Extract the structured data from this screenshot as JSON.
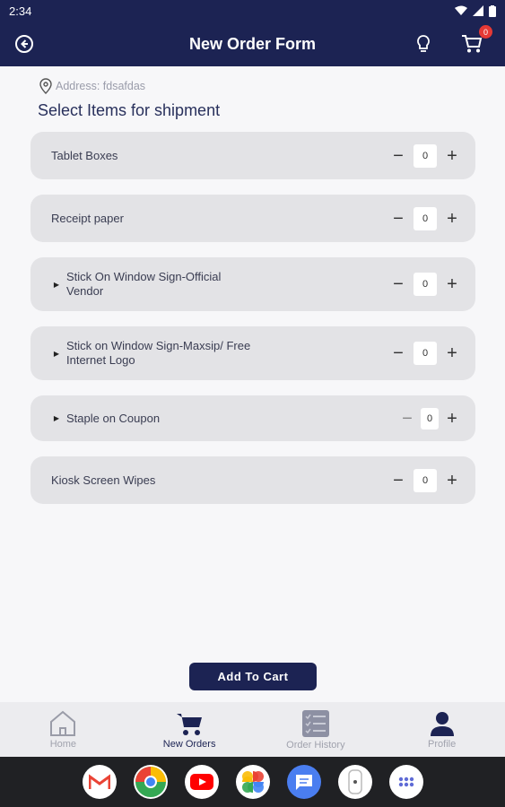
{
  "status": {
    "time": "2:34"
  },
  "appbar": {
    "title": "New Order Form",
    "cart_count": "0"
  },
  "address": {
    "text": "Address: fdsafdas"
  },
  "section_title": "Select Items for shipment",
  "items": [
    {
      "label": "Tablet Boxes",
      "qty": "0",
      "minus": "−",
      "plus": "+"
    },
    {
      "label": "Receipt paper",
      "qty": "0",
      "minus": "−",
      "plus": "+"
    },
    {
      "label": "Stick On Window Sign-Official Vendor",
      "qty": "0",
      "minus": "−",
      "plus": "+"
    },
    {
      "label": "Stick on Window Sign-Maxsip/ Free Internet Logo",
      "qty": "0",
      "minus": "−",
      "plus": "+"
    },
    {
      "label": "Staple on Coupon",
      "qty": "0",
      "minus": "−",
      "plus": "+"
    },
    {
      "label": "Kiosk Screen Wipes",
      "qty": "0",
      "minus": "−",
      "plus": "+"
    }
  ],
  "add_to_cart": "Add To Cart",
  "nav": [
    {
      "label": "Home",
      "icon": "home-icon"
    },
    {
      "label": "New Orders",
      "icon": "cart-icon"
    },
    {
      "label": "Order History",
      "icon": "checklist-icon"
    },
    {
      "label": "Profile",
      "icon": "person-icon"
    }
  ],
  "colors": {
    "primary": "#1c2353",
    "card": "#e3e3e6",
    "badge": "#e53935"
  }
}
